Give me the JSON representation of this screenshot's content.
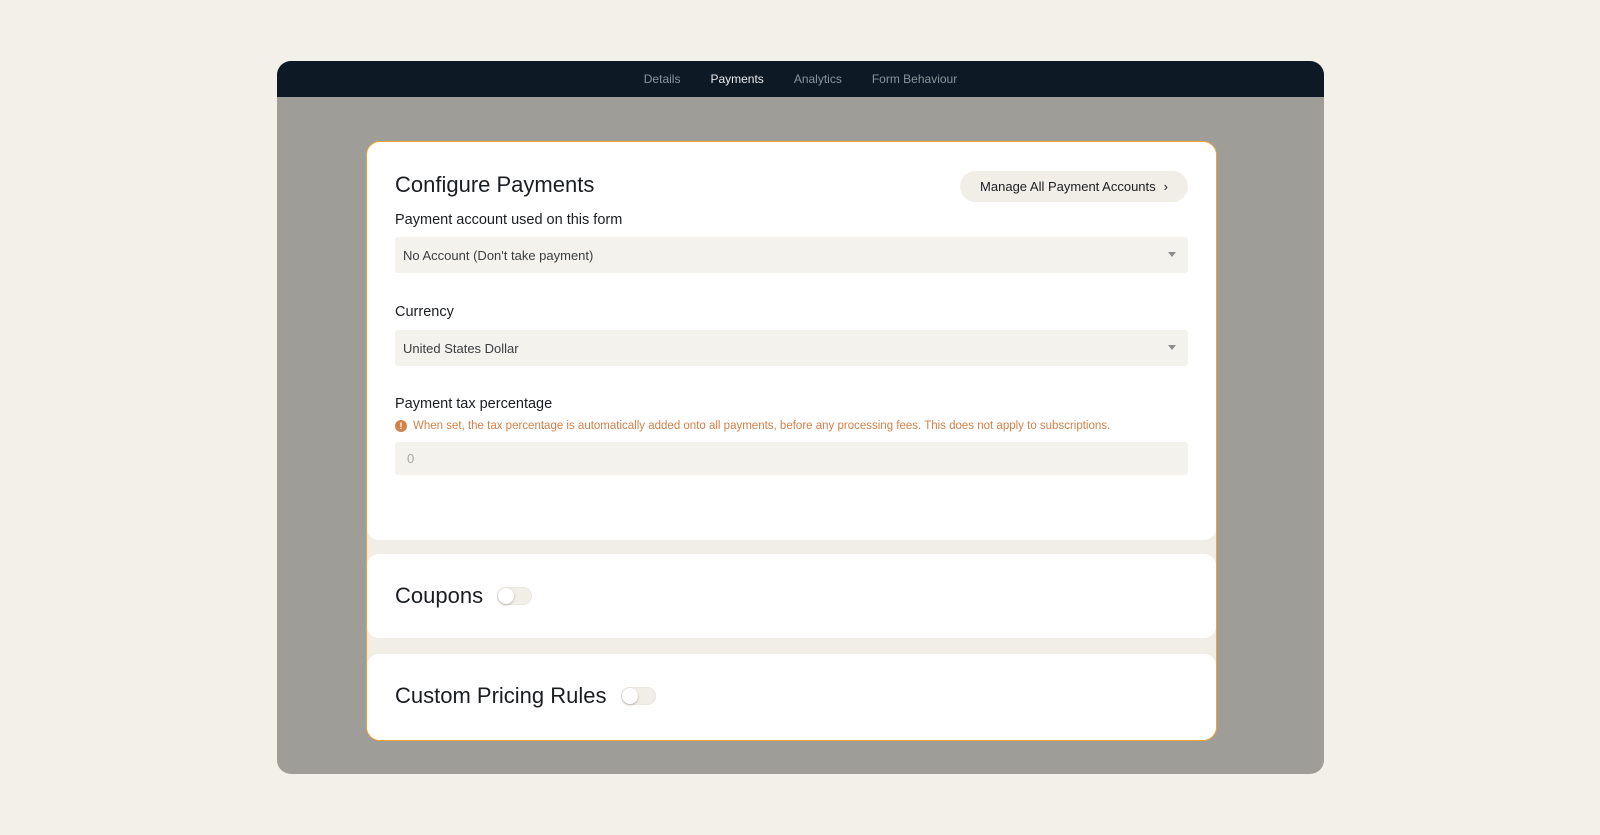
{
  "nav": {
    "tabs": [
      {
        "label": "Details"
      },
      {
        "label": "Payments"
      },
      {
        "label": "Analytics"
      },
      {
        "label": "Form Behaviour"
      }
    ],
    "active": "Payments"
  },
  "config": {
    "title": "Configure Payments",
    "manage_button": "Manage All Payment Accounts",
    "manage_chevron": "›",
    "account_label": "Payment account used on this form",
    "account_value": "No Account (Don't take payment)",
    "currency_label": "Currency",
    "currency_value": "United States Dollar",
    "tax_label": "Payment tax percentage",
    "tax_info_icon": "!",
    "tax_info": "When set, the tax percentage is automatically added onto all payments, before any processing fees. This does not apply to subscriptions.",
    "tax_placeholder": "0"
  },
  "coupons": {
    "title": "Coupons",
    "enabled": false
  },
  "pricing": {
    "title": "Custom Pricing Rules",
    "enabled": false
  },
  "colors": {
    "accent": "#f0a436",
    "warning_text": "#d1814a",
    "topbar": "#0d1a26"
  }
}
